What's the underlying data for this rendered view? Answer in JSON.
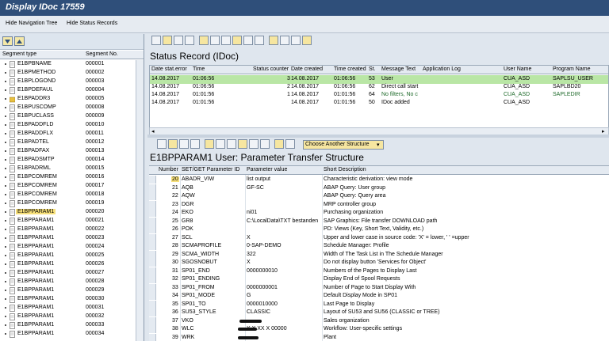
{
  "window": {
    "title": "Display IDoc 17559"
  },
  "toolbar": {
    "hide_nav": "Hide Navigation Tree",
    "hide_status": "Hide Status Records"
  },
  "tree": {
    "col_type": "Segment type",
    "col_no": "Segment No.",
    "items": [
      {
        "name": "E1BPBNAME",
        "no": "000001"
      },
      {
        "name": "E1BPMETHOD",
        "no": "000002"
      },
      {
        "name": "E1BPLOGOND",
        "no": "000003"
      },
      {
        "name": "E1BPDEFAUL",
        "no": "000004"
      },
      {
        "name": "E1BPADDR3",
        "no": "000005"
      },
      {
        "name": "E1BPUSCOMP",
        "no": "000008"
      },
      {
        "name": "E1BPUCLASS",
        "no": "000009"
      },
      {
        "name": "E1BPADDFLD",
        "no": "000010"
      },
      {
        "name": "E1BPADDFLX",
        "no": "000011"
      },
      {
        "name": "E1BPADTEL",
        "no": "000012"
      },
      {
        "name": "E1BPADFAX",
        "no": "000013"
      },
      {
        "name": "E1BPADSMTP",
        "no": "000014"
      },
      {
        "name": "E1BPADRML",
        "no": "000015"
      },
      {
        "name": "E1BPCOMREM",
        "no": "000016"
      },
      {
        "name": "E1BPCOMREM",
        "no": "000017"
      },
      {
        "name": "E1BPCOMREM",
        "no": "000018"
      },
      {
        "name": "E1BPCOMREM",
        "no": "000019"
      },
      {
        "name": "E1BPPARAM1",
        "no": "000020"
      },
      {
        "name": "E1BPPARAM1",
        "no": "000021"
      },
      {
        "name": "E1BPPARAM1",
        "no": "000022"
      },
      {
        "name": "E1BPPARAM1",
        "no": "000023"
      },
      {
        "name": "E1BPPARAM1",
        "no": "000024"
      },
      {
        "name": "E1BPPARAM1",
        "no": "000025"
      },
      {
        "name": "E1BPPARAM1",
        "no": "000026"
      },
      {
        "name": "E1BPPARAM1",
        "no": "000027"
      },
      {
        "name": "E1BPPARAM1",
        "no": "000028"
      },
      {
        "name": "E1BPPARAM1",
        "no": "000029"
      },
      {
        "name": "E1BPPARAM1",
        "no": "000030"
      },
      {
        "name": "E1BPPARAM1",
        "no": "000031"
      },
      {
        "name": "E1BPPARAM1",
        "no": "000032"
      },
      {
        "name": "E1BPPARAM1",
        "no": "000033"
      },
      {
        "name": "E1BPPARAM1",
        "no": "000034"
      }
    ]
  },
  "status": {
    "title": "Status Record (IDoc)",
    "headers": [
      "Date stat.error",
      "Time",
      "Status counter",
      "Date created",
      "Time created",
      "St.",
      "Message Text",
      "Application Log",
      "User Name",
      "Program Name"
    ],
    "rows": [
      [
        "14.08.2017",
        "01:06:56",
        "3",
        "14.08.2017",
        "01:06:56",
        "53",
        "User",
        "",
        "CUA_ASD",
        "SAPLSU_USER"
      ],
      [
        "14.08.2017",
        "01:06:56",
        "2",
        "14.08.2017",
        "01:06:56",
        "62",
        "Direct call start",
        "",
        "CUA_ASD",
        "SAPLBD20"
      ],
      [
        "14.08.2017",
        "01:01:56",
        "1",
        "14.08.2017",
        "01:01:56",
        "64",
        "No filters, No c",
        "",
        "CUA_ASD",
        "SAPLEDIR"
      ],
      [
        "14.08.2017",
        "01:01:56",
        "",
        "14.08.2017",
        "01:01:56",
        "50",
        "IDoc added",
        "",
        "CUA_ASD",
        ""
      ]
    ]
  },
  "params": {
    "select_label": "Choose Another Structure",
    "title": "E1BPPARAM1 User: Parameter Transfer Structure",
    "headers": [
      "Number",
      "SET/GET Parameter ID",
      "Parameter value",
      "Short Description"
    ],
    "rows": [
      {
        "n": "20",
        "id": "ABADR_VIW",
        "val": "list output",
        "desc": "Characteristic derivation: view mode"
      },
      {
        "n": "21",
        "id": "AQB",
        "val": "GF-SC",
        "desc": "ABAP Query: User group"
      },
      {
        "n": "22",
        "id": "AQW",
        "val": "",
        "desc": "ABAP Query: Query area"
      },
      {
        "n": "23",
        "id": "DGR",
        "val": "",
        "desc": "MRP controller group"
      },
      {
        "n": "24",
        "id": "EKO",
        "val": "ni01",
        "desc": "Purchasing organization"
      },
      {
        "n": "25",
        "id": "GR8",
        "val": "C:\\LocalData\\TXT bestanden",
        "desc": "SAP Graphics: File transfer DOWNLOAD path"
      },
      {
        "n": "26",
        "id": "POK",
        "val": "",
        "desc": "PD: Views (Key, Short Text, Validity, etc.)"
      },
      {
        "n": "27",
        "id": "SCL",
        "val": "X",
        "desc": "Upper and lower case in source code: 'X' = lower, ' ' =upper"
      },
      {
        "n": "28",
        "id": "SCMAPROFILE",
        "val": "0-SAP-DEMO",
        "desc": "Schedule Manager: Profile"
      },
      {
        "n": "29",
        "id": "SCMA_WIDTH",
        "val": "322",
        "desc": "Width of The Task List in The Schedule Manager"
      },
      {
        "n": "30",
        "id": "SGOSNOBUT",
        "val": "X",
        "desc": "Do not display button 'Services for Object'"
      },
      {
        "n": "31",
        "id": "SP01_END",
        "val": "0000000010",
        "desc": "Numbers of the Pages to Display Last"
      },
      {
        "n": "32",
        "id": "SP01_ENDING",
        "val": "",
        "desc": "Display End of Spool Requests"
      },
      {
        "n": "33",
        "id": "SP01_FROM",
        "val": "0000000001",
        "desc": "Number of Page to Start Display With"
      },
      {
        "n": "34",
        "id": "SP01_MODE",
        "val": "G",
        "desc": "Default Display Mode in SP01"
      },
      {
        "n": "35",
        "id": "SP01_TO",
        "val": "0000010000",
        "desc": "Last Page to Display"
      },
      {
        "n": "36",
        "id": "SU53_STYLE",
        "val": "CLASSIC",
        "desc": "Layout of SU53 and SU56 (CLASSIC or TREE)"
      },
      {
        "n": "37",
        "id": "VKO",
        "val": "",
        "desc": "Sales organization"
      },
      {
        "n": "38",
        "id": "WLC",
        "val": "X  X  XX   X 00000",
        "desc": "Workflow: User-specific settings"
      },
      {
        "n": "39",
        "id": "WRK",
        "val": "",
        "desc": "Plant"
      }
    ]
  },
  "colors": {
    "titlebar": "#2f4f7a",
    "selection": "#f7e07a",
    "green_row": "#b9e6a5",
    "bg": "#dfe6ee"
  }
}
